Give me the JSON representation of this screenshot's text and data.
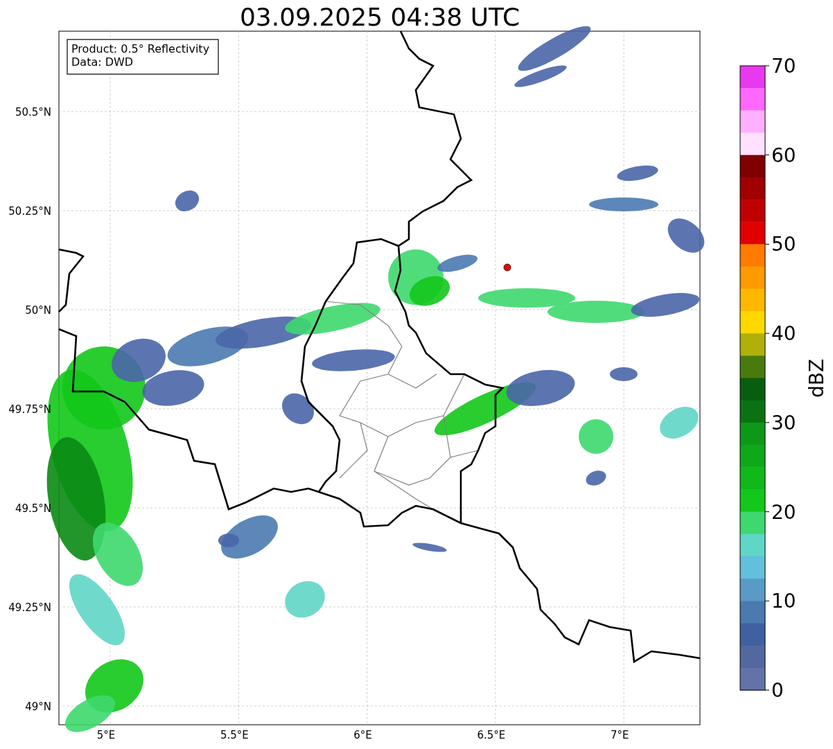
{
  "title": "03.09.2025 04:38 UTC",
  "info_box": [
    "Product: 0.5° Reflectivity",
    "Data: DWD"
  ],
  "lat_ticks": [
    "50.5°N",
    "50.25°N",
    "50°N",
    "49.75°N",
    "49.5°N",
    "49.25°N",
    "49°N"
  ],
  "lon_ticks": [
    "5°E",
    "5.5°E",
    "6°E",
    "6.5°E",
    "7°E"
  ],
  "colorbar": {
    "label": "dBZ",
    "ticks": [
      "70",
      "60",
      "50",
      "40",
      "30",
      "20",
      "10",
      "0"
    ],
    "bins": [
      {
        "color": "#e838f0"
      },
      {
        "color": "#ff68ff"
      },
      {
        "color": "#ffb0ff"
      },
      {
        "color": "#ffe0ff"
      },
      {
        "color": "#800000"
      },
      {
        "color": "#a00000"
      },
      {
        "color": "#c00000"
      },
      {
        "color": "#e00000"
      },
      {
        "color": "#ff7c00"
      },
      {
        "color": "#ff9a00"
      },
      {
        "color": "#ffb800"
      },
      {
        "color": "#ffd800"
      },
      {
        "color": "#b0b00a"
      },
      {
        "color": "#4a7a0e"
      },
      {
        "color": "#085e0e"
      },
      {
        "color": "#0a7212"
      },
      {
        "color": "#0e9818"
      },
      {
        "color": "#0ea818"
      },
      {
        "color": "#10b81a"
      },
      {
        "color": "#12c81a"
      },
      {
        "color": "#3ed86e"
      },
      {
        "color": "#5fd6c6"
      },
      {
        "color": "#62c0dc"
      },
      {
        "color": "#5a9ac6"
      },
      {
        "color": "#4a7ab0"
      },
      {
        "color": "#4060a0"
      },
      {
        "color": "#52689f"
      },
      {
        "color": "#6373a8"
      }
    ]
  }
}
